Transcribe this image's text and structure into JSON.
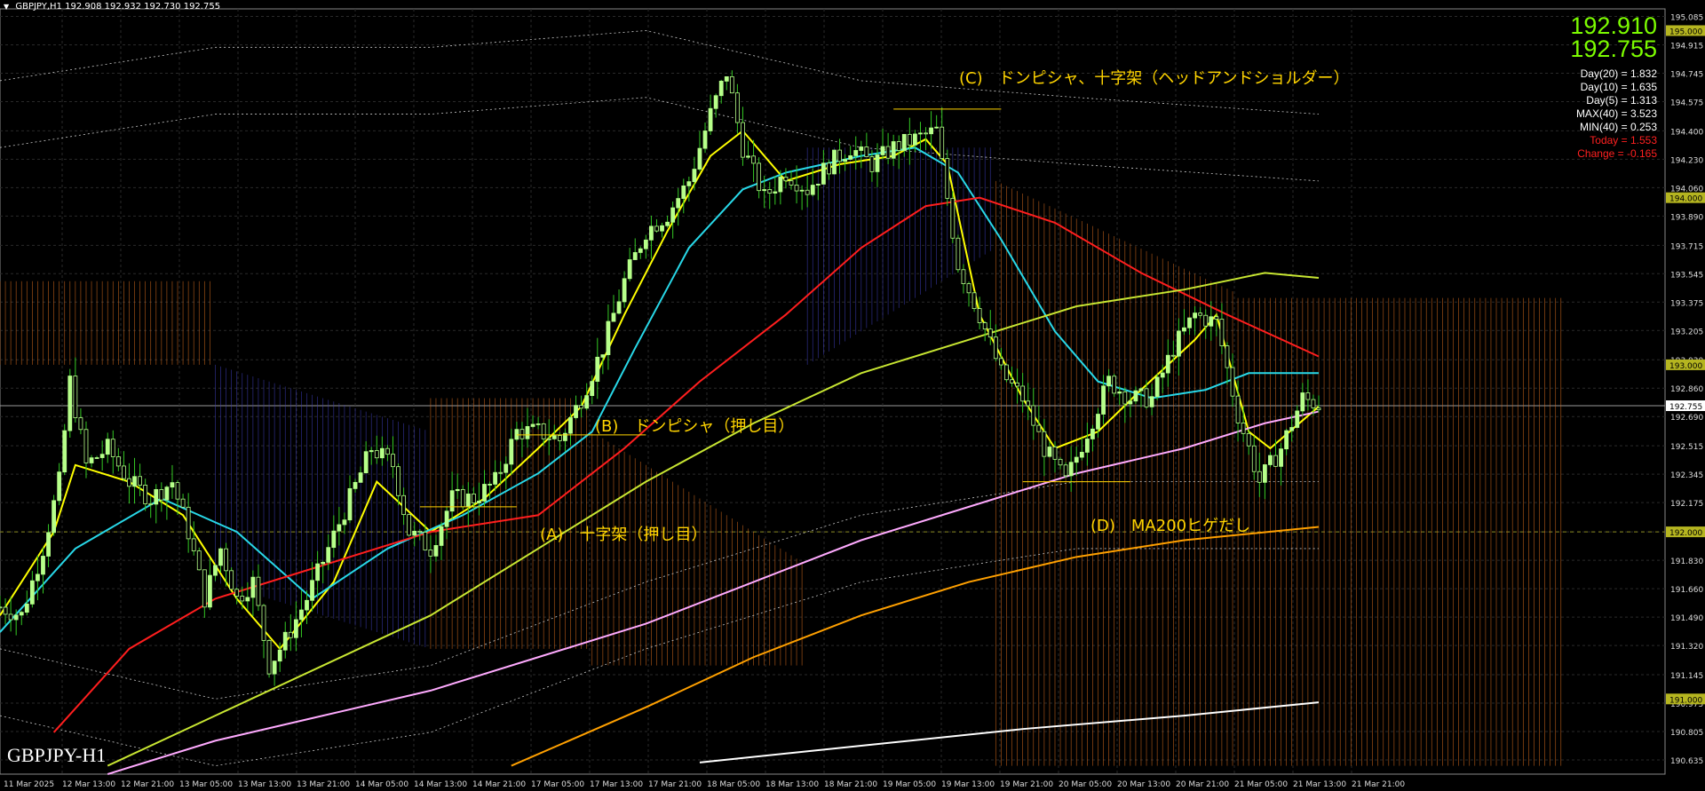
{
  "header": {
    "symbol": "GBPJPY,H1",
    "ohlc": "192.908 192.932 192.730 192.755"
  },
  "quote": {
    "bid": "192.910",
    "ask": "192.755"
  },
  "stats": {
    "lines": [
      {
        "text": "Day(20) = 1.832",
        "color": "#ffffff"
      },
      {
        "text": "Day(10) = 1.635",
        "color": "#ffffff"
      },
      {
        "text": "Day(5) = 1.313",
        "color": "#ffffff"
      },
      {
        "text": "MAX(40) = 3.523",
        "color": "#ffffff"
      },
      {
        "text": "MIN(40) = 0.253",
        "color": "#ffffff"
      },
      {
        "text": "Today = 1.553",
        "color": "#ff2020"
      },
      {
        "text": "Change = -0.165",
        "color": "#ff2020"
      }
    ]
  },
  "annotations": {
    "a": "(A)　十字架（押し目）",
    "b": "(B)　ドンピシャ（押し目）",
    "c": "(C)　ドンピシャ、十字架（ヘッドアンドショルダー）",
    "d": "(D)　MA200ヒゲだし"
  },
  "symbol_label": "GBPJPY-H1",
  "colors": {
    "bg": "#000000",
    "candle": "#b7ff8a",
    "candle_shadow": "#34c924",
    "grid": "#2a2a2a",
    "kumo_bear": "#d2691e",
    "kumo_bull": "#3c3cb4",
    "ma_yellow": "#ffff00",
    "ma_cyan": "#28d8e8",
    "ma_red": "#ff1e1e",
    "ma_olive": "#c8e632",
    "ma_pink": "#ffaaff",
    "ma_orange": "#ffa000",
    "ma_white": "#ffffff",
    "bb": "#c8c8c8",
    "annotation": "#ffd400"
  },
  "chart_data": {
    "type": "candlestick",
    "symbol": "GBPJPY",
    "timeframe": "H1",
    "y_ticks": [
      "195.085",
      "194.915",
      "194.745",
      "194.575",
      "194.400",
      "194.230",
      "194.060",
      "193.890",
      "193.715",
      "193.545",
      "193.375",
      "193.205",
      "193.030",
      "192.860",
      "192.690",
      "192.515",
      "192.345",
      "192.175",
      "192.000",
      "191.830",
      "191.660",
      "191.490",
      "191.320",
      "191.145",
      "190.975",
      "190.805",
      "190.635"
    ],
    "ylim": [
      190.55,
      195.13
    ],
    "highlighted_levels": [
      "195.000",
      "194.000",
      "193.000",
      "192.000",
      "191.000"
    ],
    "current_price": "192.755",
    "x_ticks": [
      "11 Mar 2025",
      "12 Mar 13:00",
      "12 Mar 21:00",
      "13 Mar 05:00",
      "13 Mar 13:00",
      "13 Mar 21:00",
      "14 Mar 05:00",
      "14 Mar 13:00",
      "14 Mar 21:00",
      "17 Mar 05:00",
      "17 Mar 13:00",
      "17 Mar 21:00",
      "18 Mar 05:00",
      "18 Mar 13:00",
      "18 Mar 21:00",
      "19 Mar 05:00",
      "19 Mar 13:00",
      "19 Mar 21:00",
      "20 Mar 05:00",
      "20 Mar 13:00",
      "20 Mar 21:00",
      "21 Mar 05:00",
      "21 Mar 13:00",
      "21 Mar 21:00"
    ],
    "close_path": [
      {
        "x": 0,
        "y": 191.55
      },
      {
        "x": 4,
        "y": 191.5
      },
      {
        "x": 8,
        "y": 191.9
      },
      {
        "x": 11,
        "y": 192.3
      },
      {
        "x": 13,
        "y": 192.9
      },
      {
        "x": 16,
        "y": 192.4
      },
      {
        "x": 20,
        "y": 192.5
      },
      {
        "x": 24,
        "y": 192.3
      },
      {
        "x": 28,
        "y": 192.2
      },
      {
        "x": 32,
        "y": 192.3
      },
      {
        "x": 35,
        "y": 192.0
      },
      {
        "x": 38,
        "y": 191.6
      },
      {
        "x": 41,
        "y": 191.9
      },
      {
        "x": 44,
        "y": 191.6
      },
      {
        "x": 47,
        "y": 191.7
      },
      {
        "x": 50,
        "y": 191.2
      },
      {
        "x": 53,
        "y": 191.35
      },
      {
        "x": 57,
        "y": 191.6
      },
      {
        "x": 61,
        "y": 191.9
      },
      {
        "x": 65,
        "y": 192.2
      },
      {
        "x": 69,
        "y": 192.5
      },
      {
        "x": 73,
        "y": 192.4
      },
      {
        "x": 76,
        "y": 192.0
      },
      {
        "x": 80,
        "y": 191.9
      },
      {
        "x": 84,
        "y": 192.2
      },
      {
        "x": 88,
        "y": 192.2
      },
      {
        "x": 92,
        "y": 192.3
      },
      {
        "x": 96,
        "y": 192.6
      },
      {
        "x": 100,
        "y": 192.6
      },
      {
        "x": 104,
        "y": 192.55
      },
      {
        "x": 108,
        "y": 192.8
      },
      {
        "x": 112,
        "y": 193.1
      },
      {
        "x": 116,
        "y": 193.5
      },
      {
        "x": 120,
        "y": 193.8
      },
      {
        "x": 124,
        "y": 193.9
      },
      {
        "x": 128,
        "y": 194.1
      },
      {
        "x": 132,
        "y": 194.5
      },
      {
        "x": 135,
        "y": 194.75
      },
      {
        "x": 138,
        "y": 194.3
      },
      {
        "x": 142,
        "y": 194.0
      },
      {
        "x": 146,
        "y": 194.15
      },
      {
        "x": 150,
        "y": 194.05
      },
      {
        "x": 154,
        "y": 194.2
      },
      {
        "x": 158,
        "y": 194.3
      },
      {
        "x": 162,
        "y": 194.2
      },
      {
        "x": 166,
        "y": 194.3
      },
      {
        "x": 170,
        "y": 194.35
      },
      {
        "x": 174,
        "y": 194.4
      },
      {
        "x": 178,
        "y": 193.6
      },
      {
        "x": 182,
        "y": 193.3
      },
      {
        "x": 186,
        "y": 192.95
      },
      {
        "x": 190,
        "y": 192.8
      },
      {
        "x": 194,
        "y": 192.5
      },
      {
        "x": 198,
        "y": 192.3
      },
      {
        "x": 202,
        "y": 192.6
      },
      {
        "x": 206,
        "y": 192.9
      },
      {
        "x": 210,
        "y": 192.8
      },
      {
        "x": 214,
        "y": 192.8
      },
      {
        "x": 218,
        "y": 193.1
      },
      {
        "x": 222,
        "y": 193.3
      },
      {
        "x": 226,
        "y": 193.25
      },
      {
        "x": 230,
        "y": 192.7
      },
      {
        "x": 234,
        "y": 192.3
      },
      {
        "x": 238,
        "y": 192.5
      },
      {
        "x": 242,
        "y": 192.8
      },
      {
        "x": 245,
        "y": 192.76
      }
    ],
    "moving_averages": [
      {
        "color": "#ffff00",
        "points": [
          [
            0,
            191.5
          ],
          [
            10,
            192.0
          ],
          [
            14,
            192.4
          ],
          [
            24,
            192.3
          ],
          [
            34,
            192.1
          ],
          [
            44,
            191.6
          ],
          [
            52,
            191.3
          ],
          [
            62,
            191.7
          ],
          [
            70,
            192.3
          ],
          [
            80,
            192.0
          ],
          [
            90,
            192.2
          ],
          [
            100,
            192.5
          ],
          [
            108,
            192.75
          ],
          [
            116,
            193.3
          ],
          [
            124,
            193.8
          ],
          [
            132,
            194.25
          ],
          [
            138,
            194.4
          ],
          [
            146,
            194.1
          ],
          [
            156,
            194.2
          ],
          [
            166,
            194.25
          ],
          [
            172,
            194.35
          ],
          [
            176,
            194.2
          ],
          [
            182,
            193.3
          ],
          [
            190,
            192.8
          ],
          [
            196,
            192.5
          ],
          [
            204,
            192.6
          ],
          [
            212,
            192.85
          ],
          [
            222,
            193.15
          ],
          [
            226,
            193.3
          ],
          [
            232,
            192.6
          ],
          [
            236,
            192.5
          ],
          [
            245,
            192.75
          ]
        ]
      },
      {
        "color": "#28d8e8",
        "points": [
          [
            0,
            191.4
          ],
          [
            14,
            191.9
          ],
          [
            30,
            192.2
          ],
          [
            44,
            192.0
          ],
          [
            58,
            191.6
          ],
          [
            72,
            191.9
          ],
          [
            86,
            192.1
          ],
          [
            100,
            192.35
          ],
          [
            110,
            192.6
          ],
          [
            118,
            193.1
          ],
          [
            128,
            193.7
          ],
          [
            138,
            194.05
          ],
          [
            146,
            194.15
          ],
          [
            160,
            194.25
          ],
          [
            170,
            194.3
          ],
          [
            178,
            194.15
          ],
          [
            186,
            193.75
          ],
          [
            196,
            193.2
          ],
          [
            204,
            192.9
          ],
          [
            214,
            192.8
          ],
          [
            224,
            192.85
          ],
          [
            232,
            192.95
          ],
          [
            245,
            192.95
          ]
        ]
      },
      {
        "color": "#ff1e1e",
        "points": [
          [
            10,
            190.8
          ],
          [
            24,
            191.3
          ],
          [
            40,
            191.6
          ],
          [
            60,
            191.8
          ],
          [
            80,
            192.0
          ],
          [
            100,
            192.1
          ],
          [
            116,
            192.5
          ],
          [
            130,
            192.9
          ],
          [
            146,
            193.3
          ],
          [
            160,
            193.7
          ],
          [
            172,
            193.95
          ],
          [
            182,
            194.0
          ],
          [
            196,
            193.85
          ],
          [
            212,
            193.55
          ],
          [
            228,
            193.3
          ],
          [
            245,
            193.05
          ]
        ]
      },
      {
        "color": "#c8e632",
        "points": [
          [
            20,
            190.6
          ],
          [
            40,
            190.9
          ],
          [
            60,
            191.2
          ],
          [
            80,
            191.5
          ],
          [
            100,
            191.9
          ],
          [
            120,
            192.3
          ],
          [
            140,
            192.65
          ],
          [
            160,
            192.95
          ],
          [
            180,
            193.15
          ],
          [
            200,
            193.35
          ],
          [
            220,
            193.45
          ],
          [
            235,
            193.55
          ],
          [
            245,
            193.52
          ]
        ]
      },
      {
        "color": "#ffaaff",
        "points": [
          [
            20,
            190.55
          ],
          [
            40,
            190.75
          ],
          [
            60,
            190.9
          ],
          [
            80,
            191.05
          ],
          [
            100,
            191.25
          ],
          [
            120,
            191.45
          ],
          [
            140,
            191.7
          ],
          [
            160,
            191.95
          ],
          [
            180,
            192.15
          ],
          [
            200,
            192.35
          ],
          [
            220,
            192.5
          ],
          [
            235,
            192.65
          ],
          [
            245,
            192.72
          ]
        ]
      },
      {
        "color": "#ffa000",
        "points": [
          [
            95,
            190.6
          ],
          [
            120,
            190.95
          ],
          [
            140,
            191.25
          ],
          [
            160,
            191.5
          ],
          [
            180,
            191.7
          ],
          [
            200,
            191.85
          ],
          [
            220,
            191.95
          ],
          [
            245,
            192.03
          ]
        ]
      },
      {
        "color": "#ffffff",
        "points": [
          [
            130,
            190.62
          ],
          [
            160,
            190.72
          ],
          [
            190,
            190.82
          ],
          [
            220,
            190.9
          ],
          [
            245,
            190.98
          ]
        ]
      }
    ]
  }
}
